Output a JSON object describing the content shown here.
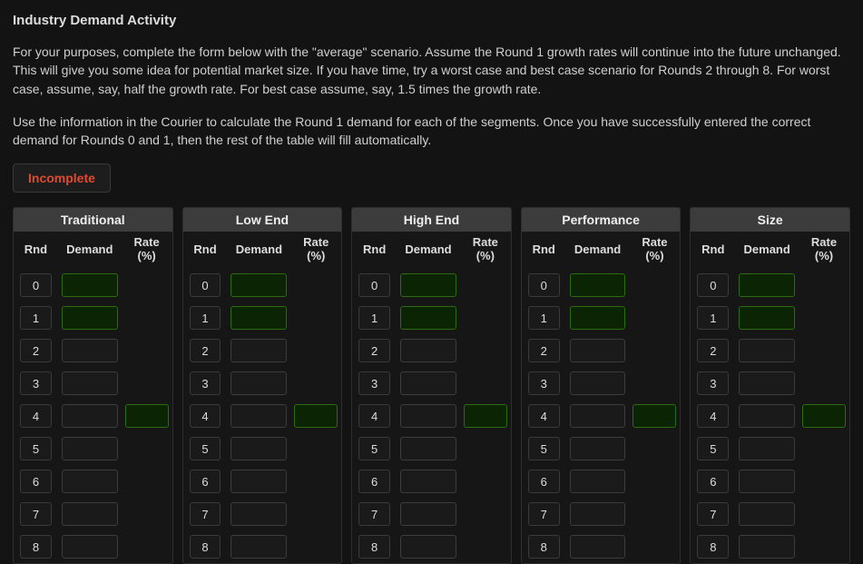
{
  "title": "Industry Demand Activity",
  "paragraph1": "For your purposes, complete the form below with the \"average\" scenario. Assume the Round 1 growth rates will continue into the future unchanged. This will give you some idea for potential market size. If you have time, try a worst case and best case scenario for Rounds 2 through 8. For worst case, assume, say, half the growth rate. For best case assume, say, 1.5 times the growth rate.",
  "paragraph2": "Use the information in the Courier to calculate the Round 1 demand for each of the segments. Once you have successfully entered the correct demand for Rounds 0 and 1, then the rest of the table will fill automatically.",
  "status_label": "Incomplete",
  "col_rnd": "Rnd",
  "col_demand": "Demand",
  "col_rate": "Rate (%)",
  "segments": [
    {
      "name": "Traditional"
    },
    {
      "name": "Low End"
    },
    {
      "name": "High End"
    },
    {
      "name": "Performance"
    },
    {
      "name": "Size"
    }
  ],
  "rounds": [
    "0",
    "1",
    "2",
    "3",
    "4",
    "5",
    "6",
    "7",
    "8"
  ],
  "editable_rounds": [
    0,
    1
  ],
  "rate_input_round": 4,
  "chart_data": {
    "type": "table",
    "title": "Industry Demand Activity",
    "columns": [
      "Rnd",
      "Demand",
      "Rate (%)"
    ],
    "segments": [
      "Traditional",
      "Low End",
      "High End",
      "Performance",
      "Size"
    ],
    "rounds": [
      0,
      1,
      2,
      3,
      4,
      5,
      6,
      7,
      8
    ],
    "values": {
      "Traditional": {
        "demand": [
          null,
          null,
          null,
          null,
          null,
          null,
          null,
          null,
          null
        ],
        "rate": [
          null,
          null,
          null,
          null,
          null,
          null,
          null,
          null,
          null
        ]
      },
      "Low End": {
        "demand": [
          null,
          null,
          null,
          null,
          null,
          null,
          null,
          null,
          null
        ],
        "rate": [
          null,
          null,
          null,
          null,
          null,
          null,
          null,
          null,
          null
        ]
      },
      "High End": {
        "demand": [
          null,
          null,
          null,
          null,
          null,
          null,
          null,
          null,
          null
        ],
        "rate": [
          null,
          null,
          null,
          null,
          null,
          null,
          null,
          null,
          null
        ]
      },
      "Performance": {
        "demand": [
          null,
          null,
          null,
          null,
          null,
          null,
          null,
          null,
          null
        ],
        "rate": [
          null,
          null,
          null,
          null,
          null,
          null,
          null,
          null,
          null
        ]
      },
      "Size": {
        "demand": [
          null,
          null,
          null,
          null,
          null,
          null,
          null,
          null,
          null
        ],
        "rate": [
          null,
          null,
          null,
          null,
          null,
          null,
          null,
          null,
          null
        ]
      }
    }
  }
}
